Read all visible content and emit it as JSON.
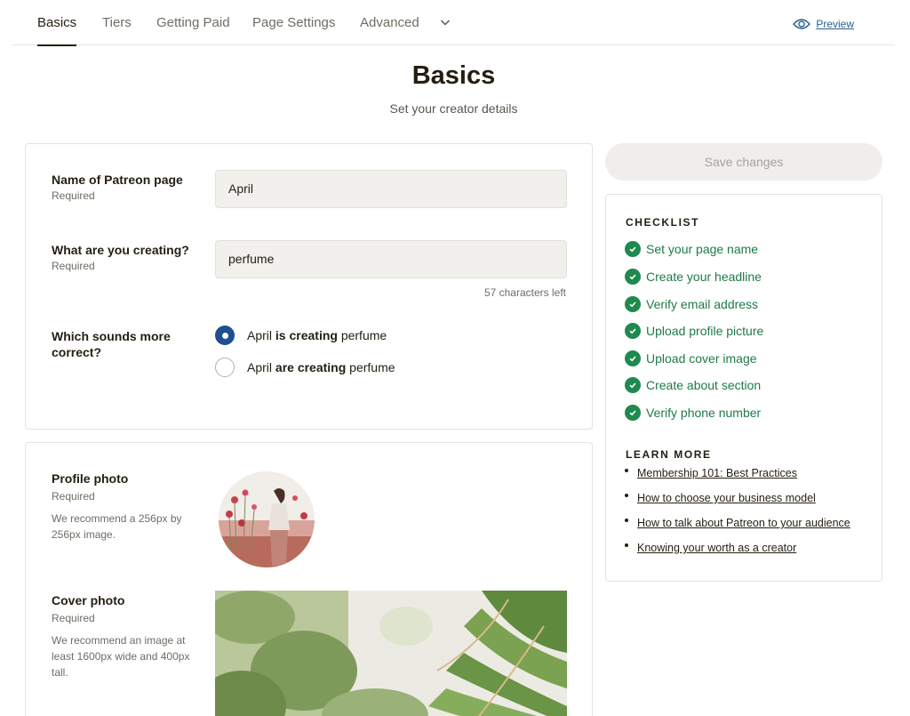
{
  "nav": {
    "tabs": [
      {
        "label": "Basics",
        "active": true
      },
      {
        "label": "Tiers",
        "active": false
      },
      {
        "label": "Getting Paid",
        "active": false
      },
      {
        "label": "Page Settings",
        "active": false
      },
      {
        "label": "Advanced",
        "active": false
      }
    ],
    "preview_label": "Preview"
  },
  "header": {
    "title": "Basics",
    "subtitle": "Set your creator details"
  },
  "form": {
    "page_name": {
      "label": "Name of Patreon page",
      "required": "Required",
      "value": "April"
    },
    "creating": {
      "label": "What are you creating?",
      "required": "Required",
      "value": "perfume",
      "counter": "57 characters left"
    },
    "grammar": {
      "label": "Which sounds more correct?",
      "options": [
        {
          "pre": "April ",
          "bold": "is creating",
          "post": " perfume",
          "selected": true
        },
        {
          "pre": "April ",
          "bold": "are creating",
          "post": " perfume",
          "selected": false
        }
      ]
    },
    "profile_photo": {
      "label": "Profile photo",
      "required": "Required",
      "hint": "We recommend a 256px by 256px image."
    },
    "cover_photo": {
      "label": "Cover photo",
      "required": "Required",
      "hint": "We recommend an image at least 1600px wide and 400px tall."
    }
  },
  "save_label": "Save changes",
  "checklist": {
    "heading": "CHECKLIST",
    "items": [
      "Set your page name",
      "Create your headline",
      "Verify email address",
      "Upload profile picture",
      "Upload cover image",
      "Create about section",
      "Verify phone number"
    ]
  },
  "learn_more": {
    "heading": "LEARN MORE",
    "links": [
      "Membership 101: Best Practices",
      "How to choose your business model",
      "How to talk about Patreon to your audience",
      "Knowing your worth as a creator"
    ]
  },
  "colors": {
    "accent_blue": "#1f4f8e",
    "check_green": "#1e8a4f",
    "link_blue": "#2a5e8e"
  }
}
